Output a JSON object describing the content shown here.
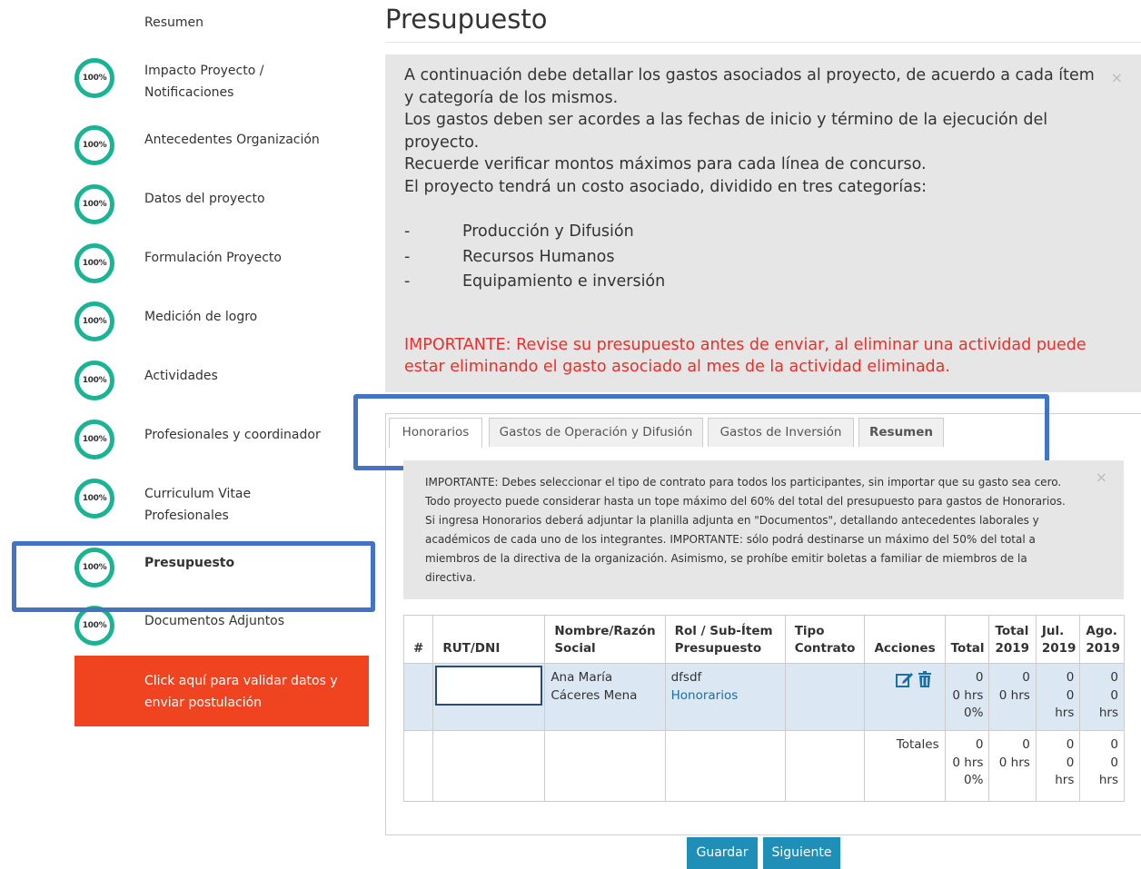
{
  "sidebar": {
    "resumen_label": "Resumen",
    "steps": [
      {
        "label": "Impacto Proyecto / Notificaciones",
        "progress": "100%"
      },
      {
        "label": "Antecedentes Organización",
        "progress": "100%"
      },
      {
        "label": "Datos del proyecto",
        "progress": "100%"
      },
      {
        "label": "Formulación Proyecto",
        "progress": "100%"
      },
      {
        "label": "Medición de logro",
        "progress": "100%"
      },
      {
        "label": "Actividades",
        "progress": "100%"
      },
      {
        "label": "Profesionales y coordinador",
        "progress": "100%"
      },
      {
        "label": "Curriculum Vitae Profesionales",
        "progress": "100%"
      },
      {
        "label": "Presupuesto",
        "progress": "100%"
      },
      {
        "label": "Documentos Adjuntos",
        "progress": "100%"
      }
    ],
    "validate_button": "Click aquí para validar datos y enviar postulación"
  },
  "main": {
    "title": "Presupuesto",
    "info": {
      "p1": "A continuación debe detallar los gastos asociados al proyecto, de acuerdo a cada ítem y categoría de los mismos.",
      "p2": "Los gastos deben ser acordes a las fechas de inicio y término de la ejecución del proyecto.",
      "p3": "Recuerde verificar montos máximos para cada línea de concurso.",
      "p4": "El proyecto tendrá un costo asociado, dividido en tres categorías:",
      "bullets": [
        "Producción y Difusión",
        "Recursos Humanos",
        "Equipamiento e inversión"
      ],
      "dash": "-",
      "warning": "IMPORTANTE: Revise su presupuesto antes de enviar, al eliminar una actividad puede estar eliminando el gasto asociado al mes de la actividad eliminada.",
      "close": "×"
    },
    "tabs": [
      "Honorarios",
      "Gastos de Operación y Difusión",
      "Gastos de Inversión",
      "Resumen"
    ],
    "notice": {
      "text": "IMPORTANTE: Debes seleccionar el tipo de contrato para todos los participantes, sin importar que su gasto sea cero. Todo proyecto puede considerar hasta un tope máximo del 60% del total del presupuesto para gastos de Honorarios. Si ingresa Honorarios deberá adjuntar la planilla adjunta en \"Documentos\", detallando antecedentes laborales y académicos de cada uno de los integrantes. IMPORTANTE: sólo podrá destinarse un máximo del 50% del total a miembros de la directiva de la organización. Asimismo, se prohíbe emitir boletas a familiar de miembros de la directiva.",
      "close": "×"
    },
    "table": {
      "headers": [
        "#",
        "RUT/DNI",
        "Nombre/Razón Social",
        "Rol / Sub-Ítem Presupuesto",
        "Tipo Contrato",
        "Acciones",
        "Total",
        "Total 2019",
        "Jul. 2019",
        "Ago. 2019"
      ],
      "row": {
        "name": "Ana María Cáceres Mena",
        "role": "dfsdf",
        "subitem": "Honorarios",
        "total": [
          "0",
          "0 hrs",
          "0%"
        ],
        "total2019": [
          "0",
          "0 hrs"
        ],
        "jul": [
          "0",
          "0",
          "hrs"
        ],
        "ago": [
          "0",
          "0",
          "hrs"
        ]
      },
      "totals": {
        "label": "Totales",
        "total": [
          "0",
          "0 hrs",
          "0%"
        ],
        "total2019": [
          "0",
          "0 hrs"
        ],
        "jul": [
          "0",
          "0",
          "hrs"
        ],
        "ago": [
          "0",
          "0",
          "hrs"
        ]
      }
    },
    "buttons": {
      "save": "Guardar",
      "next": "Siguiente"
    }
  },
  "colors": {
    "accent_ring": "#1ab394",
    "validate_bg": "#f0431f",
    "highlight_border": "#4472c4",
    "button_bg": "#1f8fb8",
    "warning_text": "#e8302b"
  }
}
